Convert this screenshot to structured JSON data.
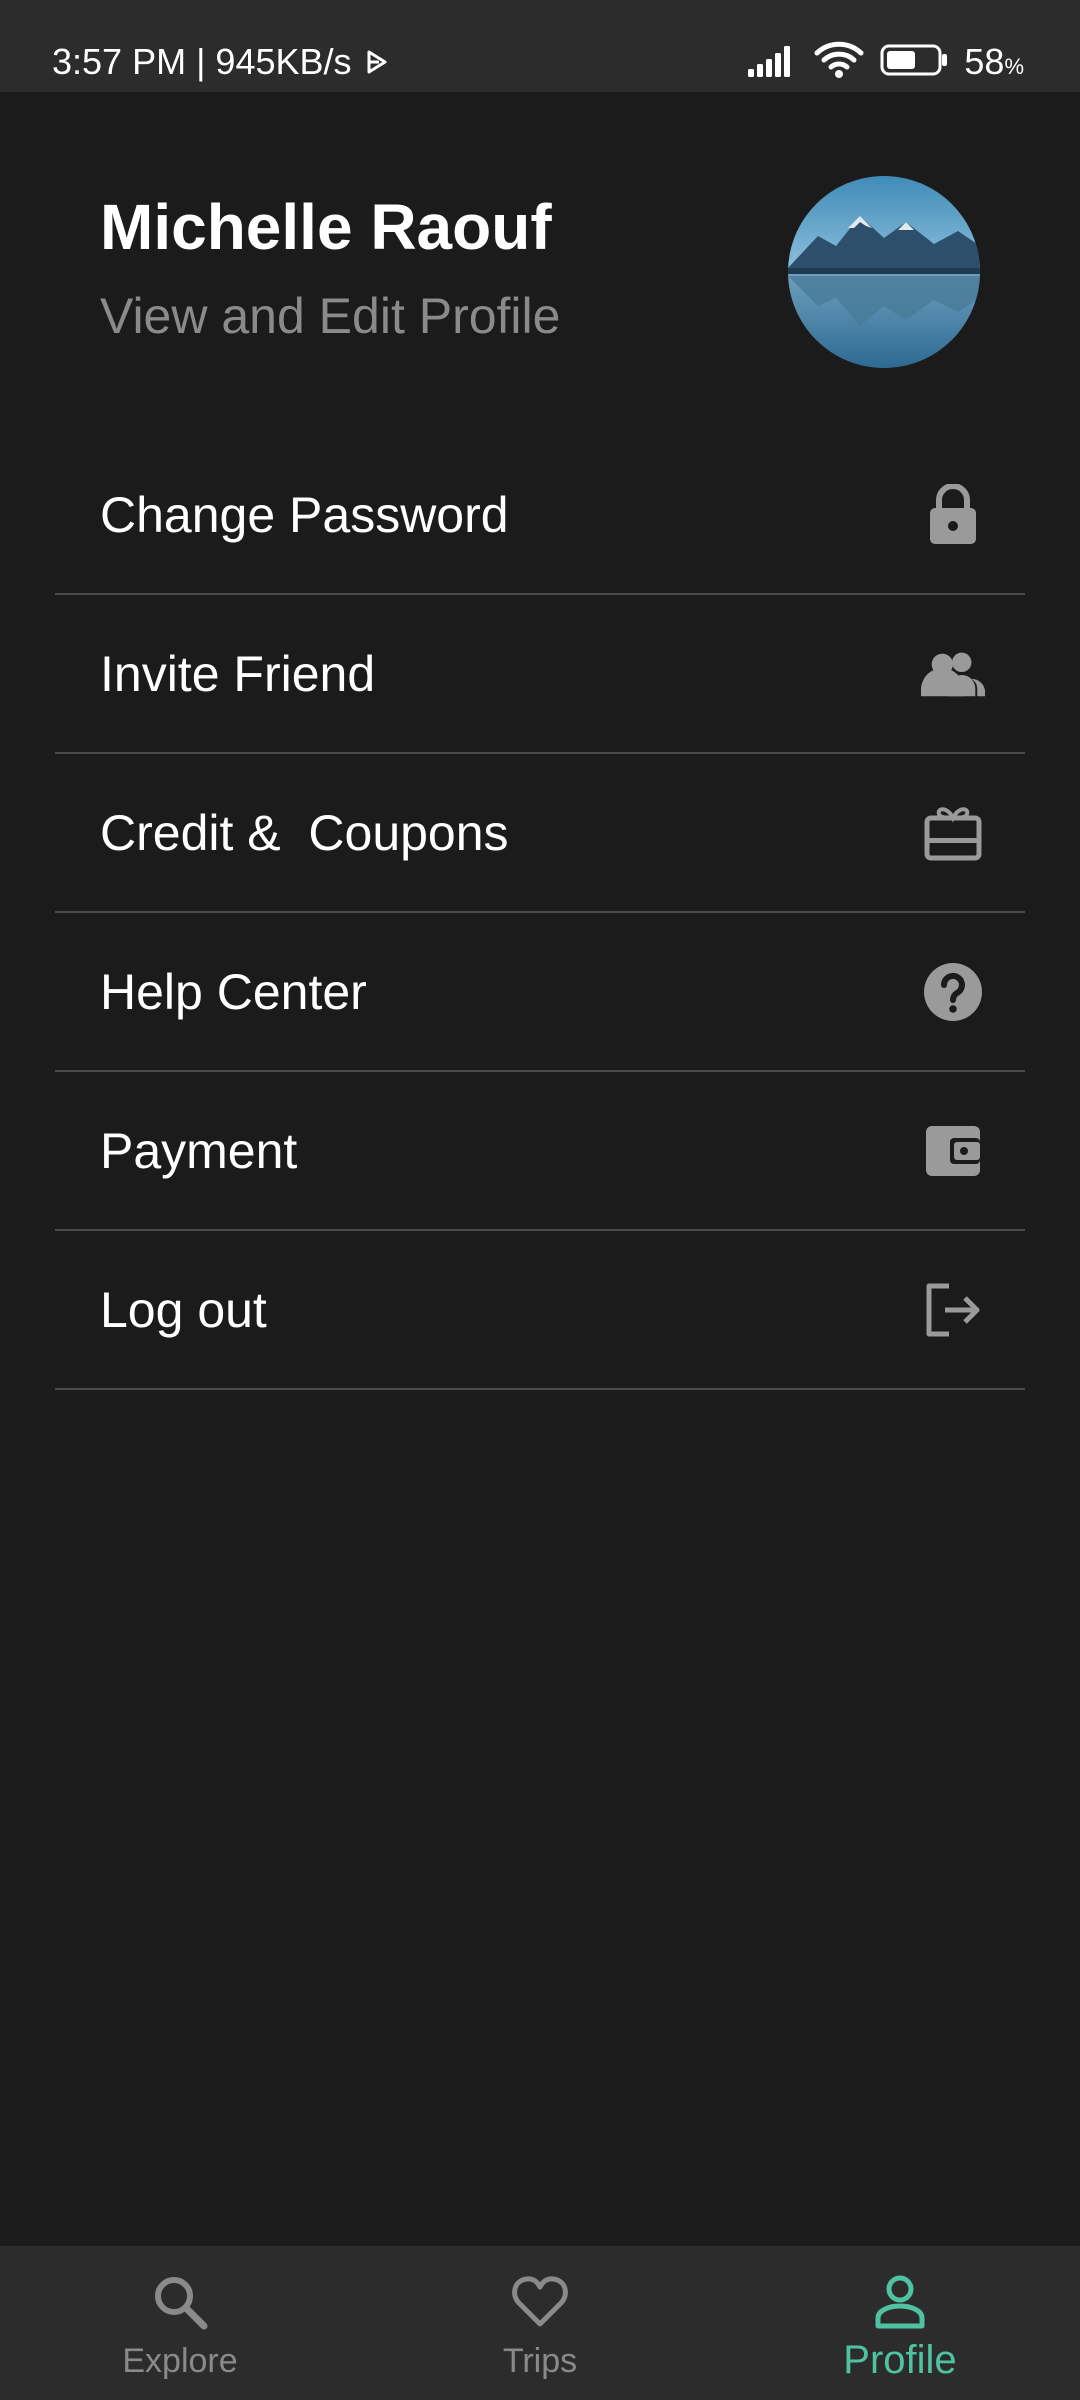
{
  "status_bar": {
    "time_speed": "3:57 PM | 945KB/s",
    "battery_percent": "58",
    "battery_unit": "%",
    "battery_level": 0.58
  },
  "profile": {
    "name": "Michelle Raouf",
    "subtitle": "View and Edit Profile"
  },
  "menu": {
    "items": [
      {
        "label": "Change Password",
        "icon": "lock-icon"
      },
      {
        "label": "Invite Friend",
        "icon": "people-icon"
      },
      {
        "label": "Credit &  Coupons",
        "icon": "gift-card-icon"
      },
      {
        "label": "Help Center",
        "icon": "help-icon"
      },
      {
        "label": "Payment",
        "icon": "wallet-icon"
      },
      {
        "label": "Log out",
        "icon": "logout-icon"
      }
    ]
  },
  "bottom_nav": {
    "items": [
      {
        "label": "Explore",
        "icon": "search-icon",
        "active": false
      },
      {
        "label": "Trips",
        "icon": "heart-icon",
        "active": false
      },
      {
        "label": "Profile",
        "icon": "person-icon",
        "active": true
      }
    ]
  },
  "colors": {
    "background": "#1b1b1b",
    "bar": "#2c2c2c",
    "accent": "#4fc3a1",
    "muted": "#8a8a8a",
    "icon": "#9a9a9a",
    "divider": "#4a4a4a"
  }
}
